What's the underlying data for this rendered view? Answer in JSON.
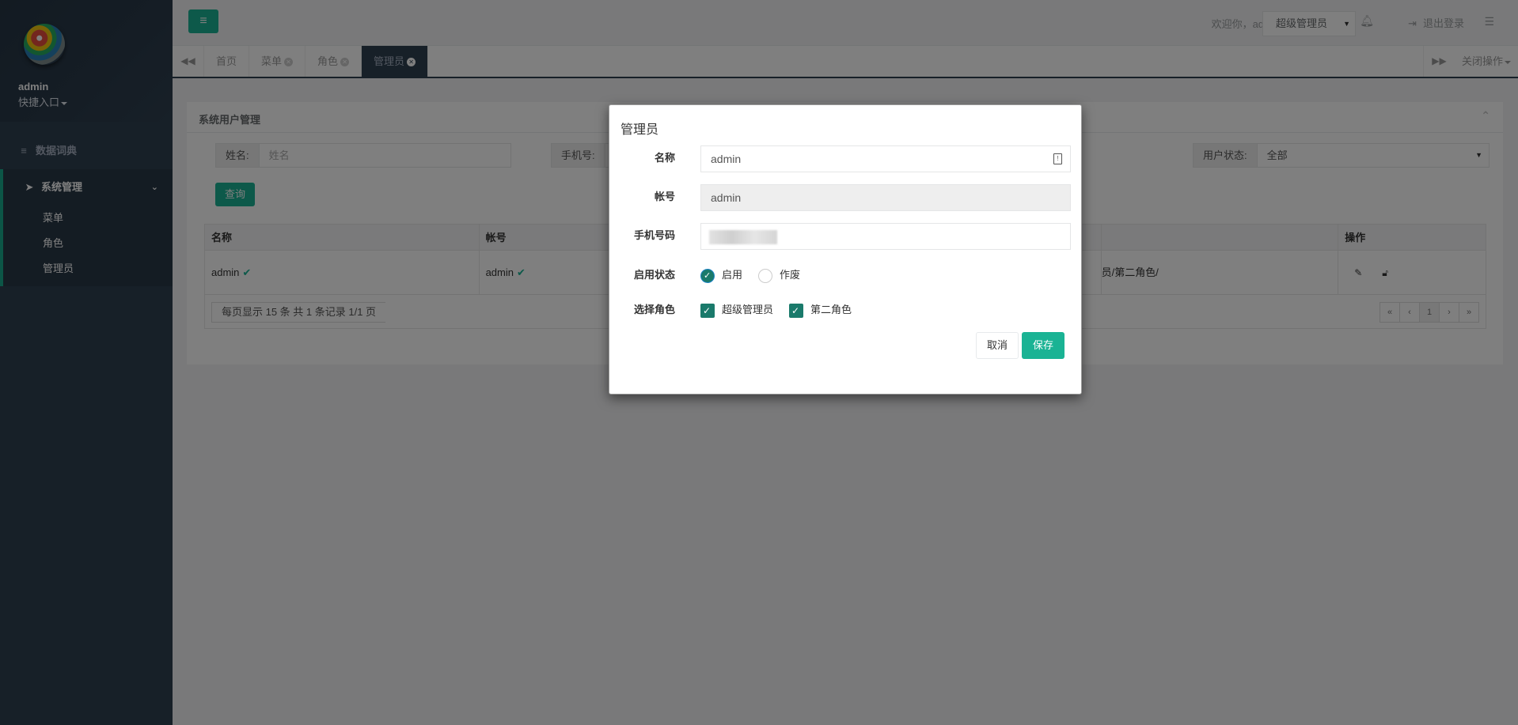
{
  "sidebar": {
    "user_name": "admin",
    "quick_entry": "快捷入口",
    "items": [
      {
        "label": "数据词典",
        "icon": "database-icon"
      },
      {
        "label": "系统管理",
        "icon": "rocket-icon"
      }
    ],
    "sub_items": [
      "菜单",
      "角色",
      "管理员"
    ]
  },
  "topbar": {
    "welcome": "欢迎你，admin",
    "role_selected": "超级管理员",
    "logout": "退出登录"
  },
  "tabs": {
    "items": [
      "首页",
      "菜单",
      "角色",
      "管理员"
    ],
    "active": "管理员",
    "close_ops": "关闭操作"
  },
  "panel": {
    "title": "系统用户管理",
    "filters": {
      "name_label": "姓名:",
      "name_placeholder": "姓名",
      "phone_label": "手机号:",
      "phone_value": "手",
      "status_label": "用户状态:",
      "status_value": "全部"
    },
    "query_button": "查询",
    "table": {
      "columns": [
        "名称",
        "帐号",
        "操作"
      ],
      "rows": [
        {
          "name": "admin",
          "account": "admin",
          "roles": "员/第二角色/"
        }
      ]
    },
    "page_info": "每页显示  15  条  共 1 条记录  1/1 页",
    "pager": [
      "«",
      "‹",
      "1",
      "›",
      "»"
    ]
  },
  "modal": {
    "title": "管理员",
    "fields": {
      "name_label": "名称",
      "name_value": "admin",
      "account_label": "帐号",
      "account_value": "admin",
      "phone_label": "手机号码",
      "status_label": "启用状态",
      "status_on": "启用",
      "status_off": "作废",
      "roles_label": "选择角色",
      "role1": "超级管理员",
      "role2": "第二角色"
    },
    "cancel": "取消",
    "save": "保存"
  }
}
